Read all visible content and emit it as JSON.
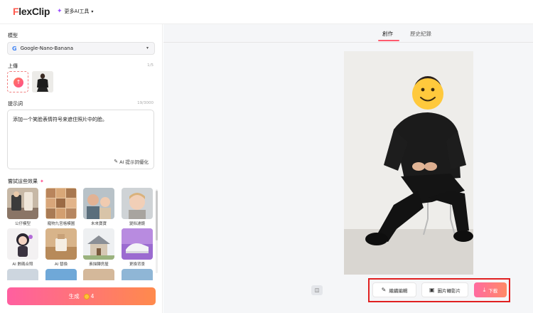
{
  "header": {
    "logo_f": "F",
    "logo_rest": "lexClip",
    "ai_menu_label": "更多AI工具"
  },
  "sidebar": {
    "model_label": "模型",
    "model_value": "Google-Nano-Banana",
    "upload_label": "上傳",
    "upload_count": "1/5",
    "prompt_label": "提示詞",
    "prompt_count": "19/3000",
    "prompt_text": "添加一个笑脸表情符号来遮住照片中的脸。",
    "optimize_label": "AI 提示詞優化",
    "effects_label": "嘗試這些效果",
    "effects": [
      {
        "label": "公仔模型"
      },
      {
        "label": "寵物九宮格模圖"
      },
      {
        "label": "未來寶寶"
      },
      {
        "label": "變拟濾鏡"
      },
      {
        "label": "AI 數碼合照"
      },
      {
        "label": "AI 替換"
      },
      {
        "label": "素描轉房屋"
      },
      {
        "label": "更換背景"
      }
    ],
    "generate_label": "生成",
    "generate_cost": "4"
  },
  "main": {
    "tabs": [
      {
        "label": "創作"
      },
      {
        "label": "歷史紀錄"
      }
    ],
    "active_tab": "創作",
    "actions": {
      "edit_label": "繼續編輯",
      "video_label": "圖片轉影片",
      "download_label": "下載"
    }
  },
  "colors": {
    "accent": "#ff5a6e",
    "highlight_border": "#e02020"
  }
}
